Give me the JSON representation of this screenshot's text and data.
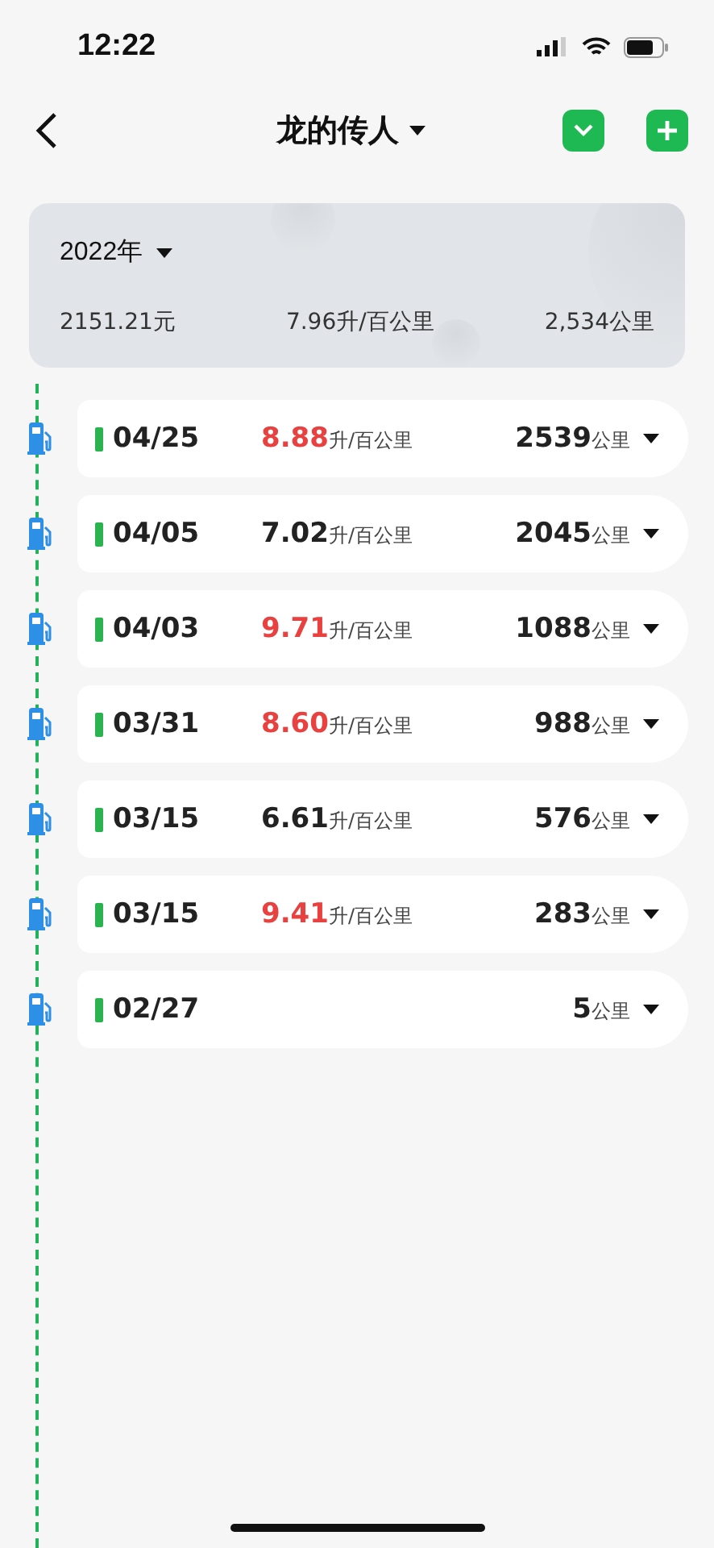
{
  "status_bar": {
    "time": "12:22"
  },
  "header": {
    "title": "龙的传人"
  },
  "summary": {
    "year": "2022年",
    "cost": "2151.21元",
    "consumption": "7.96升/百公里",
    "distance": "2,534公里"
  },
  "records": [
    {
      "date": "04/25",
      "consumption": "8.88",
      "consumption_unit": "升/百公里",
      "high": true,
      "distance": "2539",
      "distance_unit": "公里"
    },
    {
      "date": "04/05",
      "consumption": "7.02",
      "consumption_unit": "升/百公里",
      "high": false,
      "distance": "2045",
      "distance_unit": "公里"
    },
    {
      "date": "04/03",
      "consumption": "9.71",
      "consumption_unit": "升/百公里",
      "high": true,
      "distance": "1088",
      "distance_unit": "公里"
    },
    {
      "date": "03/31",
      "consumption": "8.60",
      "consumption_unit": "升/百公里",
      "high": true,
      "distance": "988",
      "distance_unit": "公里"
    },
    {
      "date": "03/15",
      "consumption": "6.61",
      "consumption_unit": "升/百公里",
      "high": false,
      "distance": "576",
      "distance_unit": "公里"
    },
    {
      "date": "03/15",
      "consumption": "9.41",
      "consumption_unit": "升/百公里",
      "high": true,
      "distance": "283",
      "distance_unit": "公里"
    },
    {
      "date": "02/27",
      "distance": "5",
      "distance_unit": "公里"
    }
  ]
}
